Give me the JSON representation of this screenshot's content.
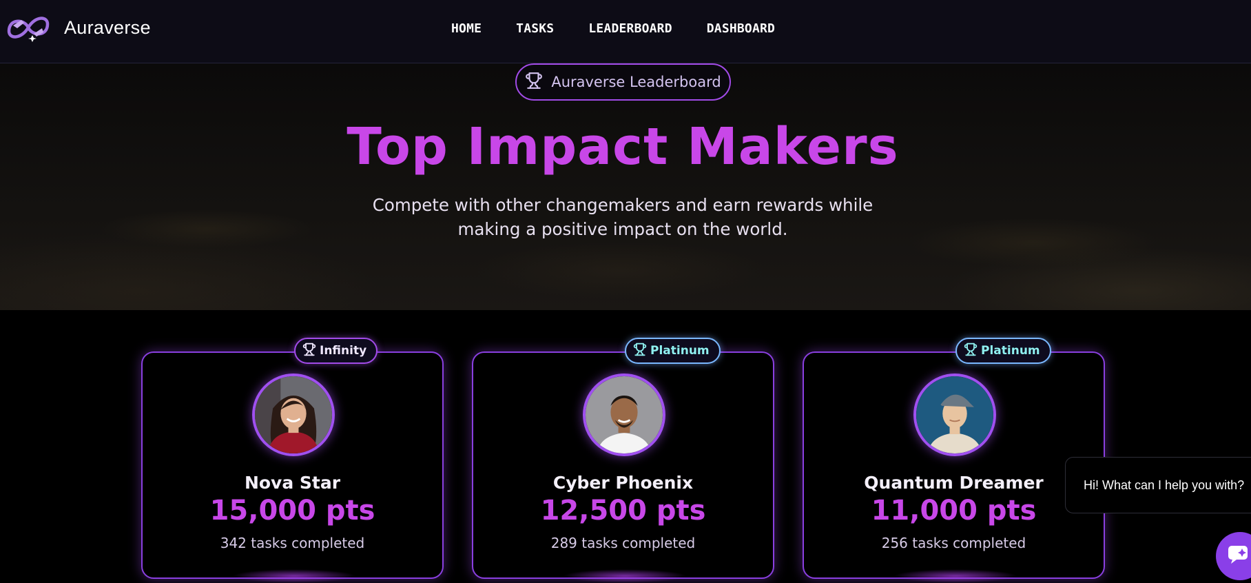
{
  "brand": {
    "name": "Auraverse",
    "logo_icon": "auraverse-logo-icon"
  },
  "nav": {
    "items": [
      {
        "label": "HOME"
      },
      {
        "label": "TASKS"
      },
      {
        "label": "LEADERBOARD"
      },
      {
        "label": "DASHBOARD"
      }
    ]
  },
  "hero": {
    "badge": {
      "icon": "trophy-icon",
      "label": "Auraverse Leaderboard"
    },
    "title": "Top Impact Makers",
    "subtitle_line1": "Compete with other changemakers and earn rewards while",
    "subtitle_line2": "making a positive impact on the world."
  },
  "leaders": [
    {
      "tier": "Infinity",
      "tier_icon": "trophy-icon",
      "name": "Nova Star",
      "points": "15,000 pts",
      "tasks": "342 tasks completed"
    },
    {
      "tier": "Platinum",
      "tier_icon": "trophy-icon",
      "name": "Cyber Phoenix",
      "points": "12,500 pts",
      "tasks": "289 tasks completed"
    },
    {
      "tier": "Platinum",
      "tier_icon": "trophy-icon",
      "name": "Quantum Dreamer",
      "points": "11,000 pts",
      "tasks": "256 tasks completed"
    }
  ],
  "chat": {
    "prompt": "Hi! What can I help you with?",
    "button_icon": "chat-icon"
  },
  "colors": {
    "accent": "#c847e8",
    "card_border": "#8a3fe0",
    "infinity_border": "#a24be8",
    "platinum_border": "#7ab8ff",
    "platinum_text": "#8ff0f0",
    "nav_bg": "#0d0c16"
  }
}
